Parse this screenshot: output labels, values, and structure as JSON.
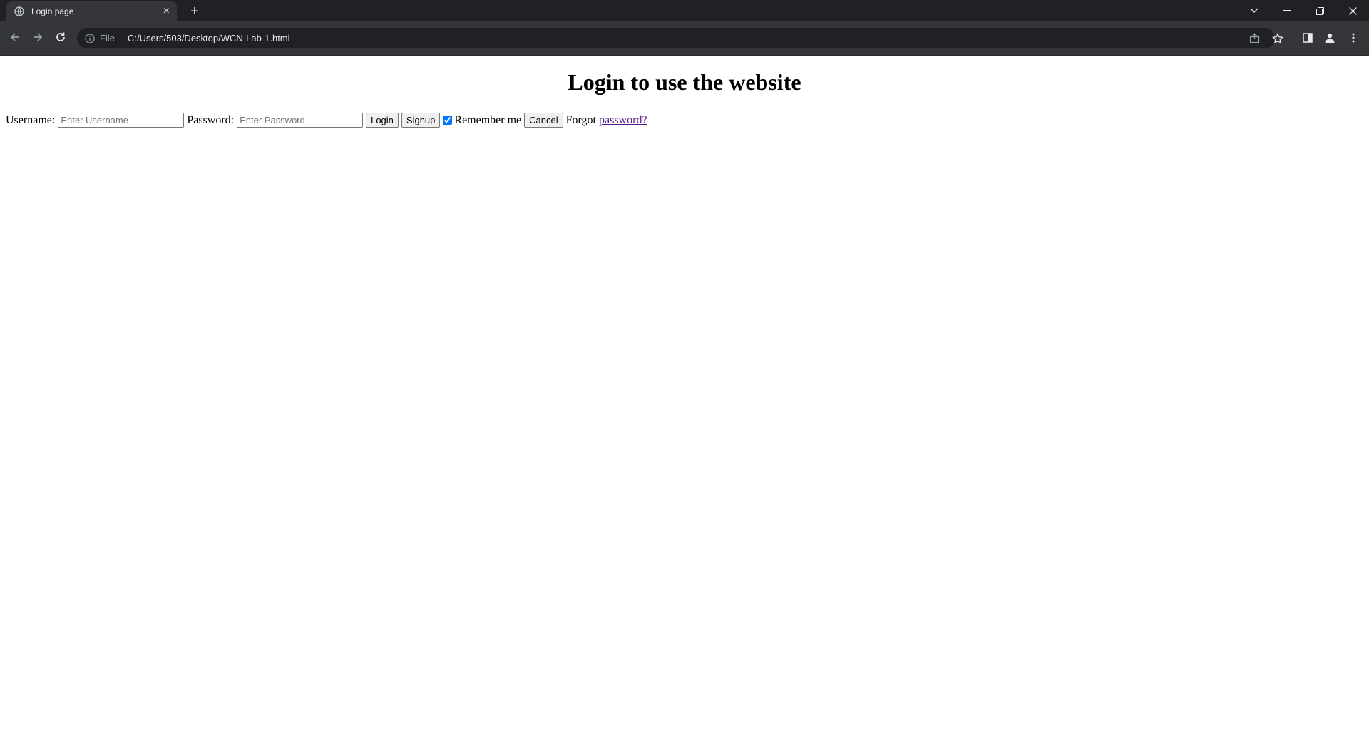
{
  "browser": {
    "tab_title": "Login page",
    "new_tab_symbol": "+",
    "address_scheme": "File",
    "address_url": "C:/Users/503/Desktop/WCN-Lab-1.html",
    "icons": [
      "globe-icon",
      "close-icon",
      "plus-icon",
      "chevron-down-icon",
      "minimize-icon",
      "restore-icon",
      "window-close-icon",
      "back-arrow-icon",
      "forward-arrow-icon",
      "reload-icon",
      "info-icon",
      "share-icon",
      "star-icon",
      "side-panel-icon",
      "profile-icon",
      "kebab-menu-icon"
    ]
  },
  "page": {
    "title": "Login to use the website",
    "username_label": "Username:",
    "username_placeholder": "Enter Username",
    "password_label": "Password:",
    "password_placeholder": "Enter Password",
    "login_button": "Login",
    "signup_button": "Signup",
    "remember_label": "Remember me",
    "remember_checked": true,
    "cancel_button": "Cancel",
    "forgot_text": "Forgot",
    "forgot_link": "password?",
    "colors": {
      "link_visited": "#551a8b",
      "checkbox_accent": "#0075ff"
    }
  }
}
